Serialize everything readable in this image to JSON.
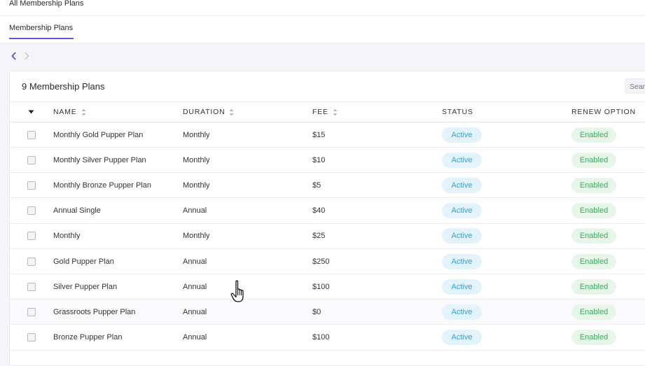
{
  "header": {
    "crumb": "All Membership Plans"
  },
  "tabs": [
    {
      "label": "Membership Plans"
    }
  ],
  "card": {
    "title": "9 Membership Plans",
    "search_placeholder": "Sear"
  },
  "table": {
    "columns": {
      "name": "NAME",
      "duration": "DURATION",
      "fee": "FEE",
      "status": "STATUS",
      "renew": "RENEW OPTION"
    },
    "rows": [
      {
        "name": "Monthly Gold Pupper Plan",
        "duration": "Monthly",
        "fee": "$15",
        "status": "Active",
        "renew": "Enabled"
      },
      {
        "name": "Monthly Silver Pupper Plan",
        "duration": "Monthly",
        "fee": "$10",
        "status": "Active",
        "renew": "Enabled"
      },
      {
        "name": "Monthly Bronze Pupper Plan",
        "duration": "Monthly",
        "fee": "$5",
        "status": "Active",
        "renew": "Enabled"
      },
      {
        "name": "Annual Single",
        "duration": "Annual",
        "fee": "$40",
        "status": "Active",
        "renew": "Enabled"
      },
      {
        "name": "Monthly",
        "duration": "Monthly",
        "fee": "$25",
        "status": "Active",
        "renew": "Enabled"
      },
      {
        "name": "Gold Pupper Plan",
        "duration": "Annual",
        "fee": "$250",
        "status": "Active",
        "renew": "Enabled"
      },
      {
        "name": "Silver Pupper Plan",
        "duration": "Annual",
        "fee": "$100",
        "status": "Active",
        "renew": "Enabled"
      },
      {
        "name": "Grassroots Pupper Plan",
        "duration": "Annual",
        "fee": "$0",
        "status": "Active",
        "renew": "Enabled"
      },
      {
        "name": "Bronze Pupper Plan",
        "duration": "Annual",
        "fee": "$100",
        "status": "Active",
        "renew": "Enabled"
      }
    ]
  },
  "colors": {
    "accent": "#6a4fd8",
    "status_active_bg": "#e3f3fc",
    "status_active_fg": "#2fa0db",
    "renew_enabled_bg": "#e8f6ea",
    "renew_enabled_fg": "#3aa85a"
  },
  "icons": {
    "prev": "chevron-left-icon",
    "next": "chevron-right-icon",
    "select_all": "caret-down-icon",
    "sort": "sort-icon",
    "cursor": "hand-pointer-icon"
  }
}
